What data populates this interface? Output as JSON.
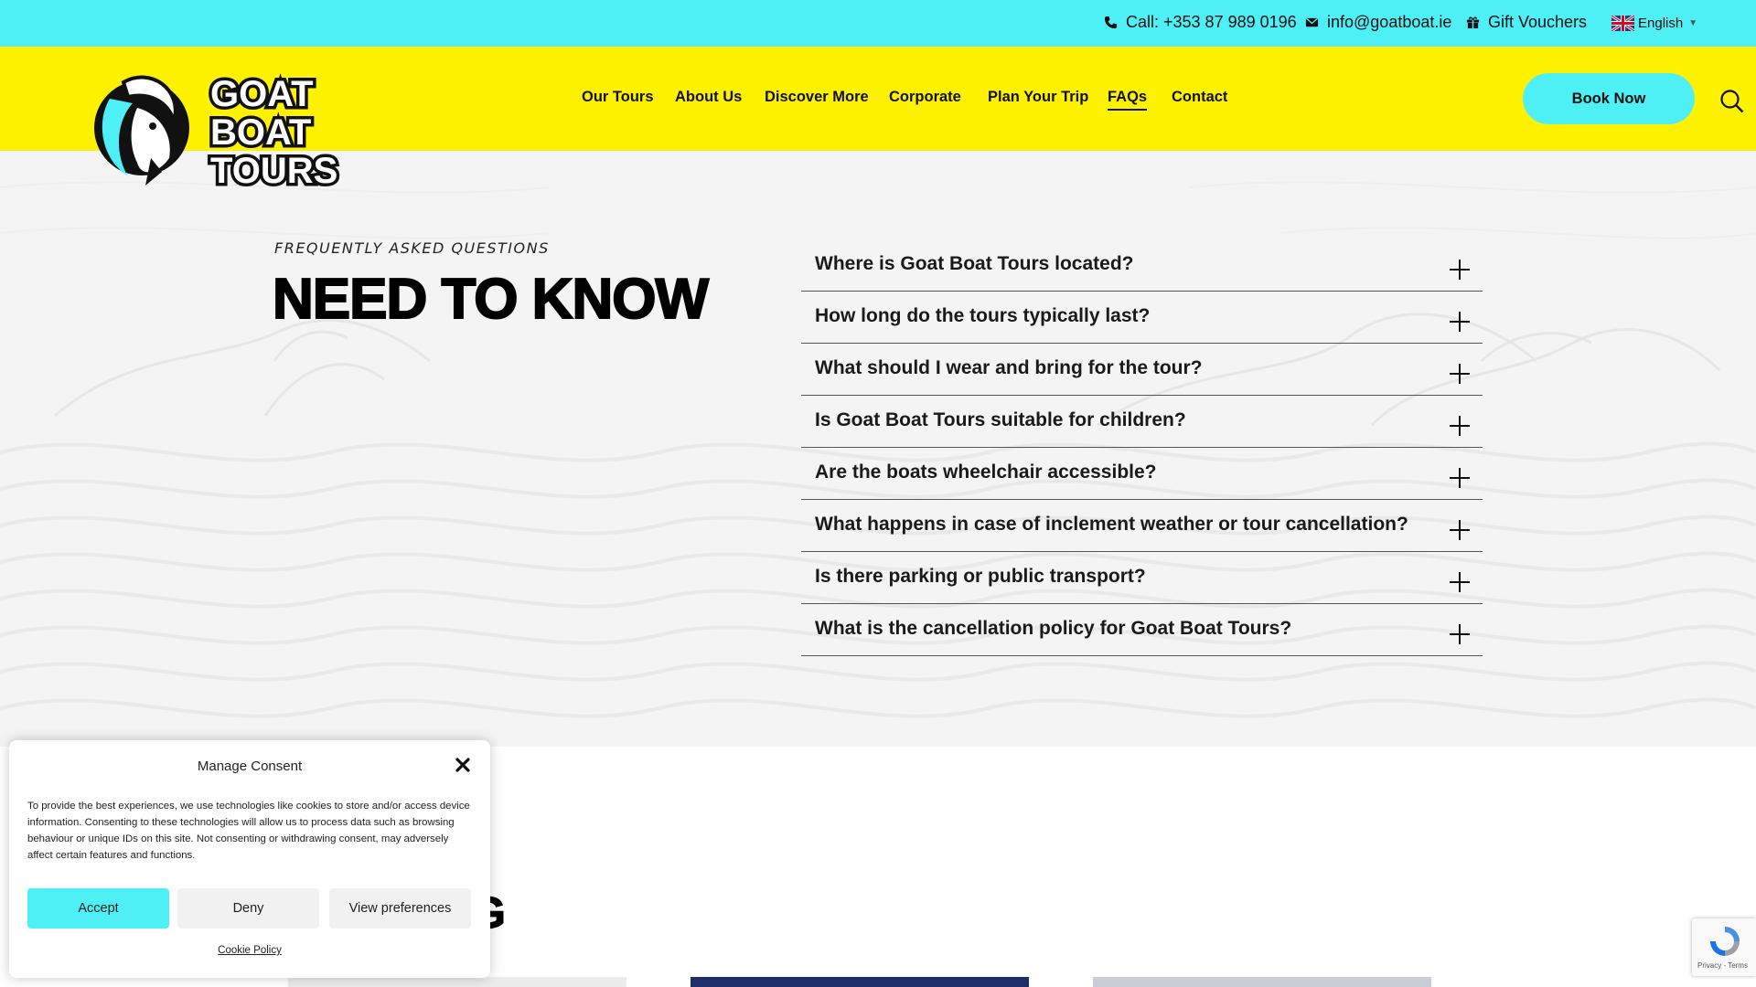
{
  "topbar": {
    "phone": "Call: +353 87 989 0196",
    "email": "info@goatboat.ie",
    "vouchers": "Gift Vouchers",
    "language": "English"
  },
  "logo": {
    "line1": "GOAT",
    "line2": "BOAT",
    "line3": "TOURS"
  },
  "nav": {
    "items": [
      {
        "label": "Our Tours"
      },
      {
        "label": "About Us"
      },
      {
        "label": "Discover More"
      },
      {
        "label": "Corporate"
      },
      {
        "label": "Plan Your Trip"
      },
      {
        "label": "FAQs"
      },
      {
        "label": "Contact"
      }
    ],
    "active": "FAQs",
    "book_label": "Book Now"
  },
  "hero": {
    "eyebrow": "FREQUENTLY ASKED QUESTIONS",
    "title": "NEED TO KNOW"
  },
  "faq": {
    "items": [
      {
        "question": "Where is Goat Boat Tours located?"
      },
      {
        "question": "How long do the tours typically last?"
      },
      {
        "question": "What should I wear and bring for the tour?"
      },
      {
        "question": "Is Goat Boat Tours suitable for children?"
      },
      {
        "question": "Are the boats wheelchair accessible?"
      },
      {
        "question": "What happens in case of inclement weather or tour cancellation?"
      },
      {
        "question": "Is there parking or public transport?"
      },
      {
        "question": "What is the cancellation policy for Goat Boat Tours?"
      }
    ]
  },
  "blog": {
    "title_fragment": "OG"
  },
  "consent": {
    "title": "Manage Consent",
    "text": "To provide the best experiences, we use technologies like cookies to store and/or access device information. Consenting to these technologies will allow us to process data such as browsing behaviour or unique IDs on this site. Not consenting or withdrawing consent, may adversely affect certain features and functions.",
    "accept": "Accept",
    "deny": "Deny",
    "preferences": "View preferences",
    "policy": "Cookie Policy"
  },
  "recaptcha": {
    "links": "Privacy - Terms"
  },
  "colors": {
    "cyan": "#4ef0f6",
    "yellow": "#fff200"
  }
}
